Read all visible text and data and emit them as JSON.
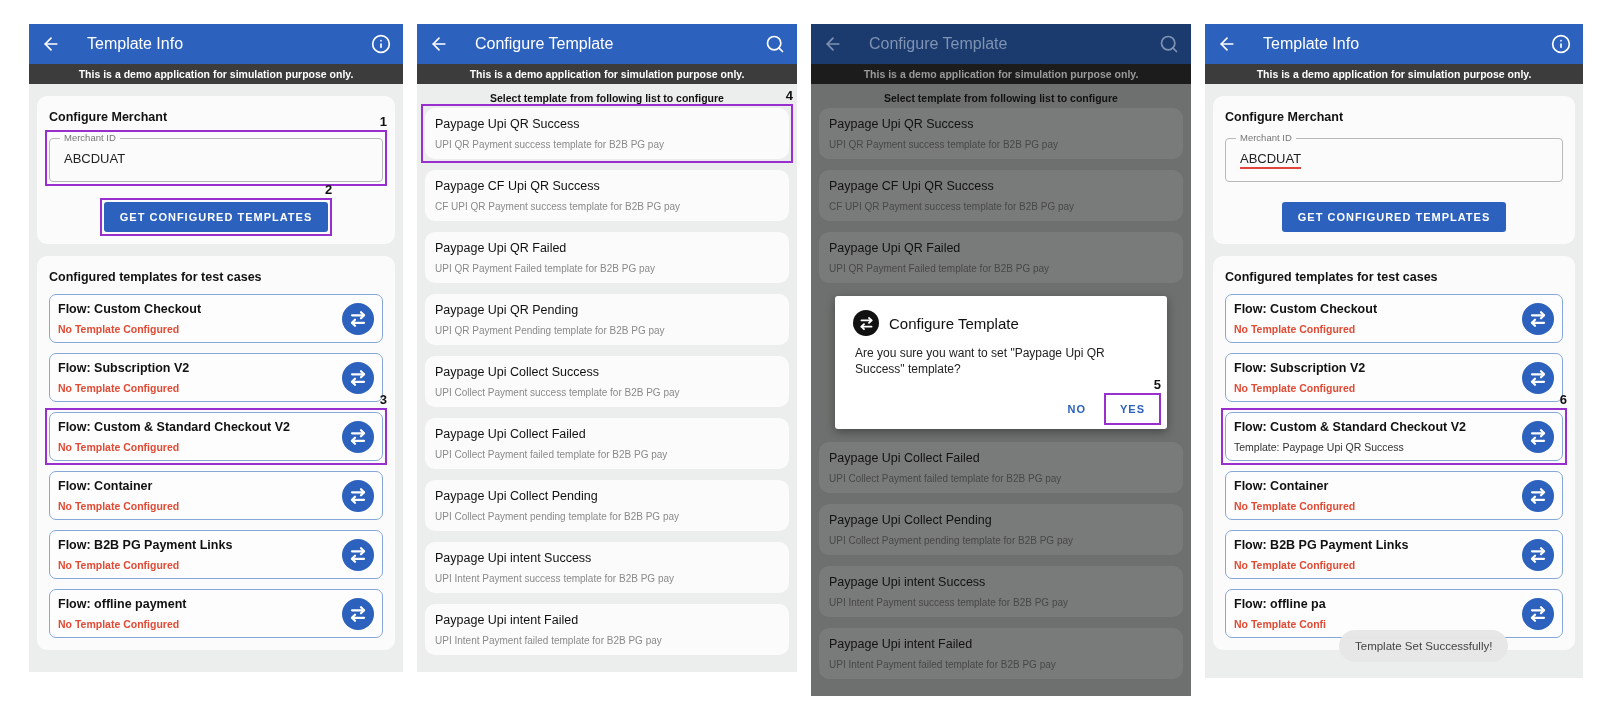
{
  "screens": [
    {
      "kind": "template_info",
      "title": "Template Info",
      "banner": "This is a demo application for simulation purpose only.",
      "dimmed": false,
      "merchant": {
        "heading": "Configure Merchant",
        "label": "Merchant ID",
        "value": "ABCDUAT",
        "misspelled": false,
        "annotation": "1"
      },
      "button": {
        "label": "GET CONFIGURED TEMPLATES",
        "annotation": "2"
      },
      "flows_heading": "Configured templates for test cases",
      "flows": [
        {
          "name": "Flow: Custom Checkout",
          "status": "No Template Configured",
          "configured": false
        },
        {
          "name": "Flow: Subscription V2",
          "status": "No Template Configured",
          "configured": false
        },
        {
          "name": "Flow: Custom & Standard Checkout V2",
          "status": "No Template Configured",
          "configured": false,
          "annotation": "3"
        },
        {
          "name": "Flow: Container",
          "status": "No Template Configured",
          "configured": false
        },
        {
          "name": "Flow: B2B PG Payment Links",
          "status": "No Template Configured",
          "configured": false
        },
        {
          "name": "Flow: offline payment",
          "status": "No Template Configured",
          "configured": false
        }
      ]
    },
    {
      "kind": "template_list",
      "title": "Configure Template",
      "banner": "This is a demo application for simulation purpose only.",
      "dimmed": false,
      "instruction": "Select template from following list to configure",
      "templates": [
        {
          "title": "Paypage Upi QR Success",
          "subtitle": "UPI QR Payment success template for B2B PG pay",
          "annotation": "4"
        },
        {
          "title": "Paypage CF Upi QR Success",
          "subtitle": "CF UPI QR Payment success template for B2B PG pay"
        },
        {
          "title": "Paypage Upi QR Failed",
          "subtitle": "UPI QR Payment Failed template for B2B PG pay"
        },
        {
          "title": "Paypage Upi QR Pending",
          "subtitle": "UPI QR Payment Pending template for B2B PG pay"
        },
        {
          "title": "Paypage Upi Collect Success",
          "subtitle": "UPI Collect Payment success template for B2B PG pay"
        },
        {
          "title": "Paypage Upi Collect Failed",
          "subtitle": "UPI Collect Payment failed template for B2B PG pay"
        },
        {
          "title": "Paypage Upi Collect Pending",
          "subtitle": "UPI Collect Payment pending template for B2B PG pay"
        },
        {
          "title": "Paypage Upi intent Success",
          "subtitle": "UPI Intent Payment success template for B2B PG pay"
        },
        {
          "title": "Paypage Upi intent Failed",
          "subtitle": "UPI Intent Payment failed template for B2B PG pay"
        }
      ]
    },
    {
      "kind": "template_list",
      "title": "Configure Template",
      "banner": "This is a demo application for simulation purpose only.",
      "dimmed": true,
      "instruction": "Select template from following list to configure",
      "templates": [
        {
          "title": "Paypage Upi QR Success",
          "subtitle": "UPI QR Payment success template for B2B PG pay"
        },
        {
          "title": "Paypage CF Upi QR Success",
          "subtitle": "CF UPI QR Payment success template for B2B PG pay"
        },
        {
          "title": "Paypage Upi QR Failed",
          "subtitle": "UPI QR Payment Failed template for B2B PG pay"
        }
      ],
      "dialog": {
        "title": "Configure Template",
        "message": "Are you sure you want to set \"Paypage Upi QR Success\" template?",
        "buttons": [
          {
            "label": "NO"
          },
          {
            "label": "YES",
            "annotation": "5"
          }
        ]
      },
      "templates_after": [
        {
          "title": "Paypage Upi Collect Failed",
          "subtitle": "UPI Collect Payment failed template for B2B PG pay"
        },
        {
          "title": "Paypage Upi Collect Pending",
          "subtitle": "UPI Collect Payment pending template for B2B PG pay"
        },
        {
          "title": "Paypage Upi intent Success",
          "subtitle": "UPI Intent Payment success template for B2B PG pay"
        },
        {
          "title": "Paypage Upi intent Failed",
          "subtitle": "UPI Intent Payment failed template for B2B PG pay"
        }
      ]
    },
    {
      "kind": "template_info",
      "title": "Template Info",
      "banner": "This is a demo application for simulation purpose only.",
      "dimmed": false,
      "merchant": {
        "heading": "Configure Merchant",
        "label": "Merchant ID",
        "value": "ABCDUAT",
        "misspelled": true
      },
      "button": {
        "label": "GET CONFIGURED TEMPLATES"
      },
      "flows_heading": "Configured templates for test cases",
      "flows": [
        {
          "name": "Flow: Custom Checkout",
          "status": "No Template Configured",
          "configured": false
        },
        {
          "name": "Flow: Subscription V2",
          "status": "No Template Configured",
          "configured": false
        },
        {
          "name": "Flow: Custom & Standard Checkout V2",
          "status": "Template: Paypage Upi QR Success",
          "configured": true,
          "annotation": "6"
        },
        {
          "name": "Flow: Container",
          "status": "No Template Configured",
          "configured": false
        },
        {
          "name": "Flow: B2B PG Payment Links",
          "status": "No Template Configured",
          "configured": false
        },
        {
          "name": "Flow: offline pa",
          "status": "No Template Confi",
          "configured": false
        }
      ],
      "toast": "Template Set Successfully!"
    }
  ]
}
